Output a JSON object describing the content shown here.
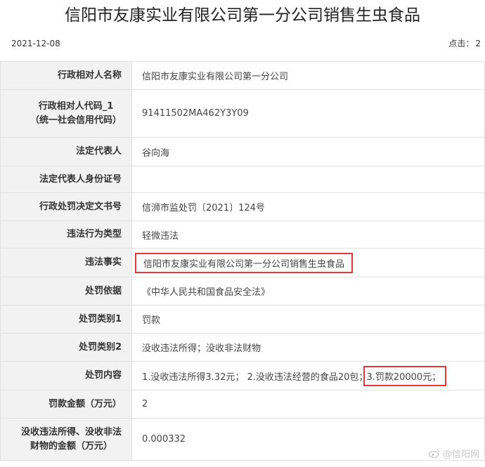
{
  "page": {
    "title": "信阳市友康实业有限公司第一分公司销售生虫食品",
    "date": "2021-12-08",
    "views_label": "点击：",
    "views_count": "2"
  },
  "rows": [
    {
      "label": "行政相对人名称",
      "value": "信阳市友康实业有限公司第一分公司"
    },
    {
      "label_line1": "行政相对人代码_1",
      "label_line2": "（统一社会信用代码）",
      "value": "91411502MA462Y3Y09"
    },
    {
      "label": "法定代表人",
      "value": "谷向海"
    },
    {
      "label": "法定代表人身份证号",
      "value": ""
    },
    {
      "label": "行政处罚决定文书号",
      "value": "信浉市监处罚〔2021〕124号"
    },
    {
      "label": "违法行为类型",
      "value": "轻微违法"
    },
    {
      "label": "违法事实",
      "value": "信阳市友康实业有限公司第一分公司销售生虫食品"
    },
    {
      "label": "处罚依据",
      "value": "《中华人民共和国食品安全法》"
    },
    {
      "label": "处罚类别1",
      "value": "罚款"
    },
    {
      "label": "处罚类别2",
      "value": "没收违法所得；没收非法财物"
    },
    {
      "label": "处罚内容",
      "value_part1": "1.没收违法所得3.32元； 2.没收违法经营的食品20包；",
      "value_part2": "3.罚款20000元；"
    },
    {
      "label": "罚款金额（万元）",
      "value": "2"
    },
    {
      "label_line1": "没收违法所得、没收非法",
      "label_line2": "财物的金额（万元）",
      "value": "0.000332"
    }
  ],
  "watermark": {
    "icon": "weibo-icon",
    "text": "@信阳网"
  },
  "colors": {
    "highlight_border": "#e5373b",
    "label_bg": "#f2f2f2",
    "border": "#e1e1e1"
  }
}
